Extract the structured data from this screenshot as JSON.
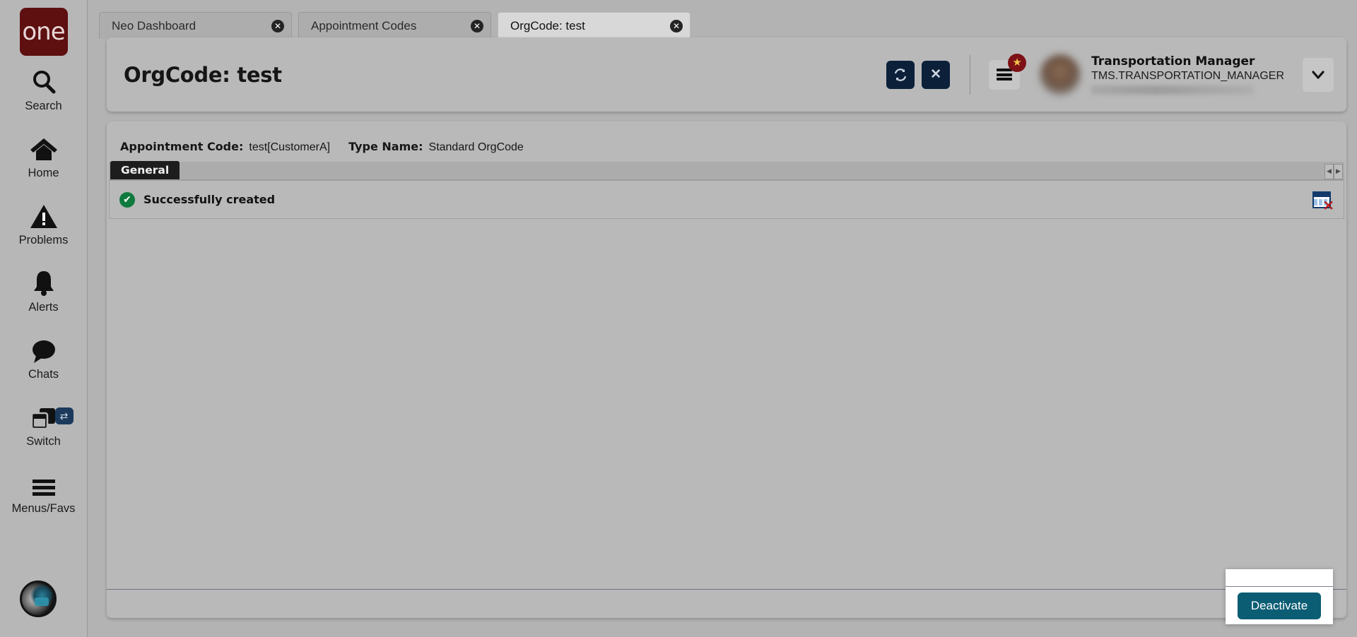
{
  "brand": {
    "logo_text": "one"
  },
  "rail": {
    "items": [
      {
        "label": "Search",
        "icon": "search-icon"
      },
      {
        "label": "Home",
        "icon": "home-icon"
      },
      {
        "label": "Problems",
        "icon": "warning-triangle-icon"
      },
      {
        "label": "Alerts",
        "icon": "bell-icon"
      },
      {
        "label": "Chats",
        "icon": "chat-bubble-icon"
      },
      {
        "label": "Switch",
        "icon": "switch-windows-icon",
        "badge": "⇄"
      },
      {
        "label": "Menus/Favs",
        "icon": "hamburger-icon"
      }
    ],
    "assistant": {
      "name": "ai-assistant-avatar"
    }
  },
  "tabs": [
    {
      "label": "Neo Dashboard",
      "active": false,
      "close": "✕"
    },
    {
      "label": "Appointment Codes",
      "active": false,
      "close": "✕"
    },
    {
      "label": "OrgCode: test",
      "active": true,
      "close": "✕"
    }
  ],
  "header": {
    "title": "OrgCode: test",
    "refresh_icon": "⟳",
    "close_icon": "✕",
    "favorites_badge": "★",
    "caret_icon": "⌄",
    "user": {
      "name": "Transportation Manager",
      "role": "TMS.TRANSPORTATION_MANAGER"
    }
  },
  "content": {
    "info": [
      {
        "key": "Appointment Code:",
        "value": "test[CustomerA]"
      },
      {
        "key": "Type Name:",
        "value": "Standard OrgCode"
      }
    ],
    "tab_general": "General",
    "scroll_left": "◀",
    "scroll_right": "▶",
    "message": {
      "icon": "✔",
      "text": "Successfully created"
    },
    "grid_clear_icon": "✕"
  },
  "footer": {
    "deactivate_label": "Deactivate"
  },
  "colors": {
    "brand_red": "#5e0f10",
    "header_button_navy": "#0c203a",
    "active_tab_underline": "#1d2b45",
    "success_green": "#0f7a3d",
    "deactivate_teal": "#0b5d73",
    "badge_red": "#7e1116",
    "page_background": "#b3b3b3"
  }
}
